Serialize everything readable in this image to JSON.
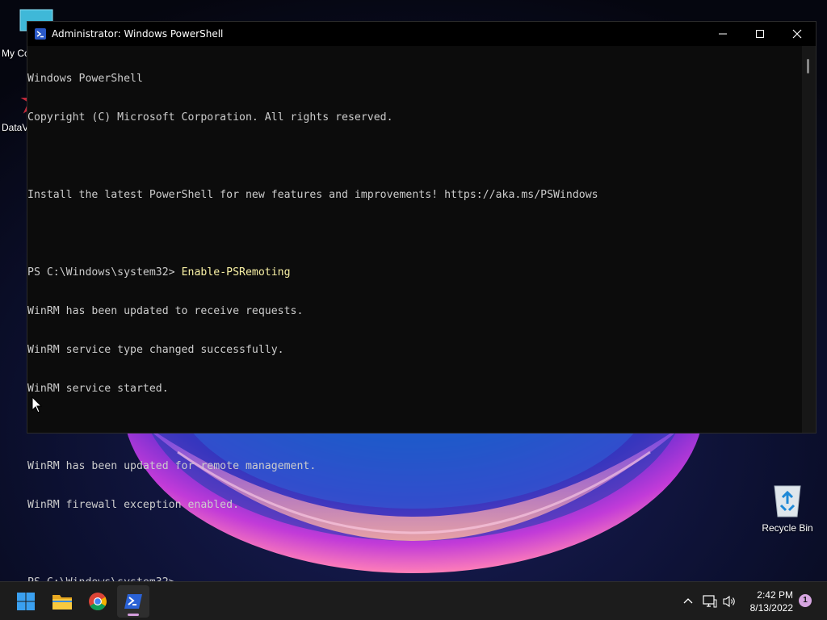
{
  "window": {
    "title": "Administrator: Windows PowerShell"
  },
  "console": {
    "lines": [
      "Windows PowerShell",
      "Copyright (C) Microsoft Corporation. All rights reserved.",
      "",
      "Install the latest PowerShell for new features and improvements! https://aka.ms/PSWindows",
      "",
      "PS C:\\Windows\\system32> ",
      "WinRM has been updated to receive requests.",
      "WinRM service type changed successfully.",
      "WinRM service started.",
      "",
      "WinRM has been updated for remote management.",
      "WinRM firewall exception enabled.",
      "",
      "PS C:\\Windows\\system32>"
    ],
    "command": "Enable-PSRemoting",
    "command_color": "#f9f1a5",
    "text_color": "#cccccc"
  },
  "desktop": {
    "icons": [
      {
        "label": "My Co",
        "icon": "computer-icon"
      },
      {
        "label": "DataV",
        "icon": "shortcut-app-icon"
      },
      {
        "label": "Recycle Bin",
        "icon": "recycle-bin-icon"
      }
    ]
  },
  "taskbar": {
    "apps": [
      {
        "name": "Start",
        "icon": "windows-start-icon"
      },
      {
        "name": "File Explorer",
        "icon": "folder-icon"
      },
      {
        "name": "Google Chrome",
        "icon": "chrome-icon"
      },
      {
        "name": "Windows PowerShell",
        "icon": "powershell-icon",
        "active": true
      }
    ],
    "tray": {
      "icons": [
        "chevron-up-icon",
        "network-icon",
        "volume-icon"
      ],
      "time": "2:42 PM",
      "date": "8/13/2022",
      "notification_count": "1"
    }
  }
}
